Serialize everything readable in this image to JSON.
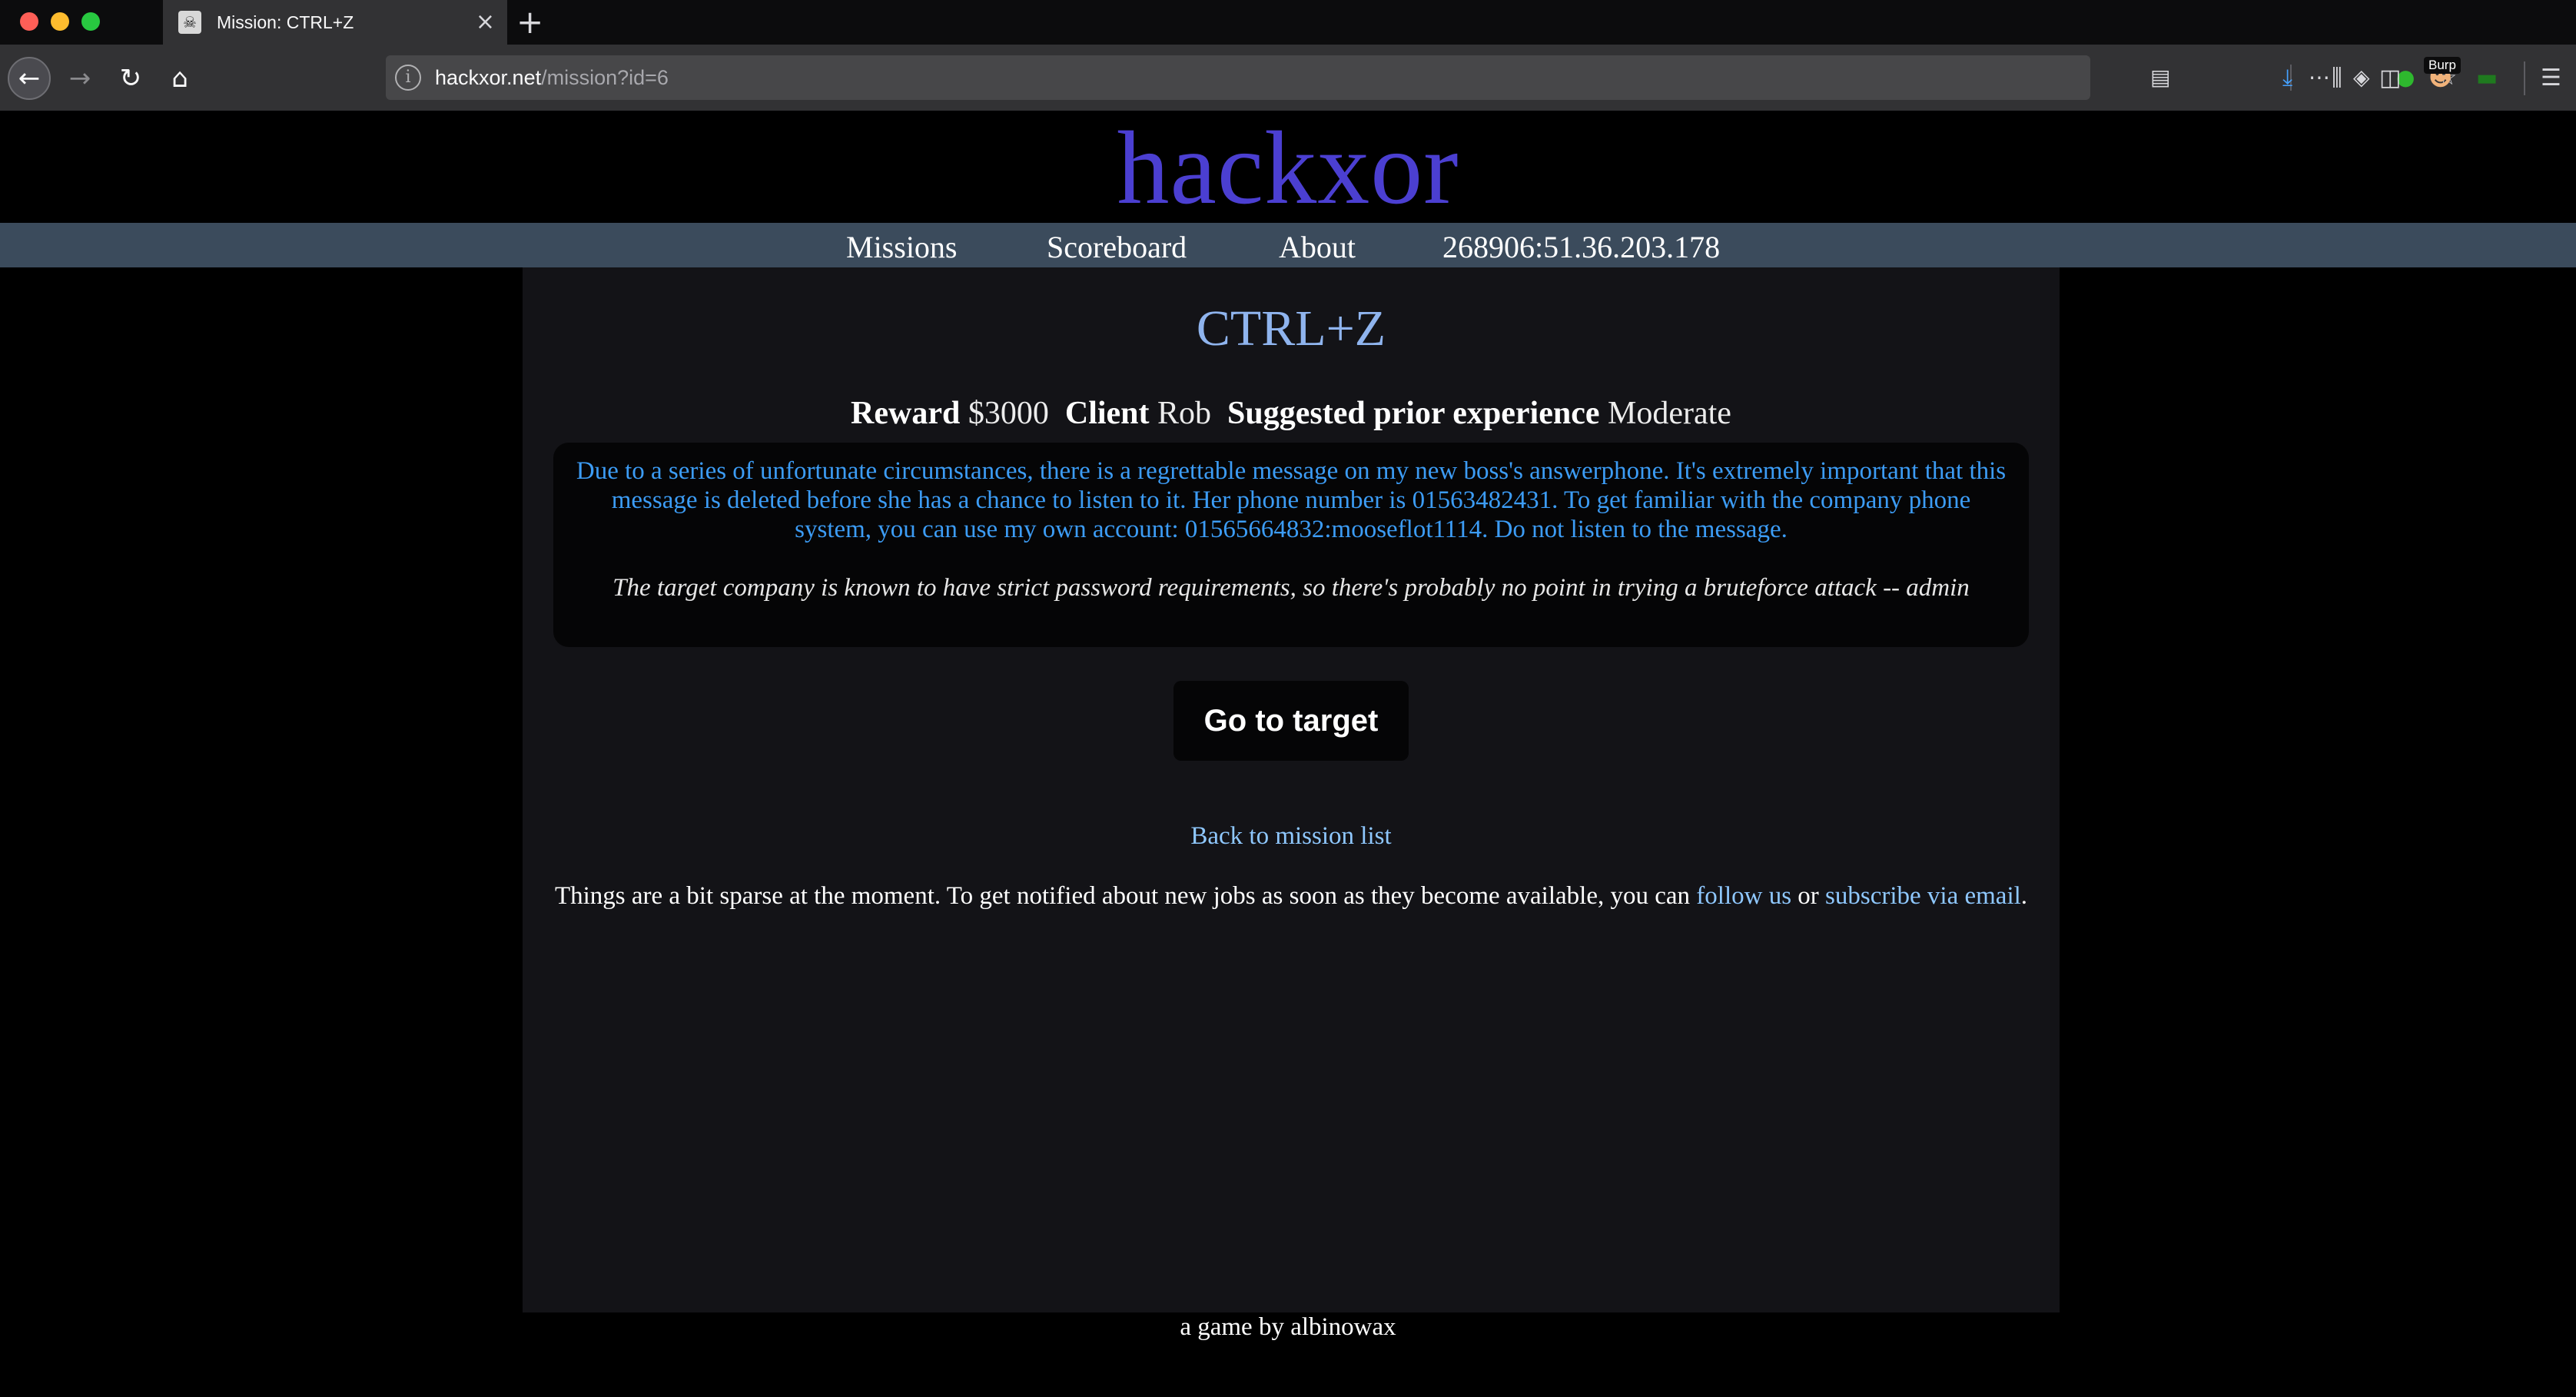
{
  "browser": {
    "tab_title": "Mission: CTRL+Z",
    "tab_favicon": "skull-icon",
    "url_domain": "hackxor.net",
    "url_path": "/mission?id=6",
    "toolbar_badge": "Burp"
  },
  "site": {
    "title": "hackxor",
    "nav": {
      "missions": "Missions",
      "scoreboard": "Scoreboard",
      "about": "About",
      "session": "268906:51.36.203.178"
    }
  },
  "mission": {
    "title": "CTRL+Z",
    "reward_label": "Reward",
    "reward_value": "$3000",
    "client_label": "Client",
    "client_value": "Rob",
    "experience_label": "Suggested prior experience",
    "experience_value": "Moderate",
    "briefing": "Due to a series of unfortunate circumstances, there is a regrettable message on my new boss's answerphone. It's extremely important that this message is deleted before she has a chance to listen to it. Her phone number is 01563482431. To get familiar with the company phone system, you can use my own account: 01565664832:mooseflot1114. Do not listen to the message.",
    "admin_note": "The target company is known to have strict password requirements, so there's probably no point in trying a bruteforce attack -- admin",
    "go_button": "Go to target",
    "back_link": "Back to mission list"
  },
  "notice": {
    "text_before": "Things are a bit sparse at the moment. To get notified about new jobs as soon as they become available, you can ",
    "follow_link": "follow us",
    "text_middle": " or ",
    "subscribe_link": "subscribe via email",
    "text_after": "."
  },
  "footer": {
    "text": "a game by albinowax"
  },
  "colors": {
    "title": "#4b3fd1",
    "nav_bar": "#3b4b5c",
    "mission_title": "#8fb4ee",
    "briefing_text": "#3c9cf5",
    "link": "#8fc8ff"
  }
}
